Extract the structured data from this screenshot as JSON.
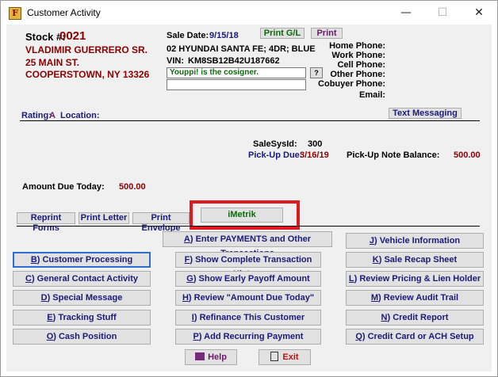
{
  "window": {
    "title": "Customer Activity",
    "icon": "app-logo-icon",
    "controls": {
      "minimize": "—",
      "maximize": "☐",
      "close": "✕"
    }
  },
  "customer": {
    "stock_label": "Stock #:",
    "stock_number": "0021",
    "name": "VLADIMIR GUERRERO SR.",
    "street": "25 MAIN ST.",
    "city_state_zip": "COOPERSTOWN, NY 13326"
  },
  "sale": {
    "sale_date_label": "Sale Date:",
    "sale_date": "9/15/18",
    "vehicle": "02 HYUNDAI SANTA FE; 4DR; BLUE",
    "vin_label": "VIN:",
    "vin": "KM8SB12B42U187662",
    "print_gl_label": "Print G/L",
    "print_label": "Print",
    "cosigner_message": "Youppi! is the cosigner.",
    "help_glyph": "?"
  },
  "phones": {
    "home": "Home Phone:",
    "work": "Work Phone:",
    "cell": "Cell Phone:",
    "other": "Other Phone:",
    "cobuyer": "Cobuyer Phone:",
    "email": "Email:"
  },
  "rating": {
    "rating_label": "Rating:",
    "rating_value": "A",
    "location_label": "Location:"
  },
  "text_messaging_label": "Text Messaging",
  "account": {
    "salesysid_label": "SaleSysId:",
    "salesysid": "300",
    "pickup_due_label": "Pick-Up Due:",
    "pickup_due": "3/16/19",
    "pickup_balance_label": "Pick-Up Note Balance:",
    "pickup_balance": "500.00",
    "amount_due_label": "Amount Due Today:",
    "amount_due": "500.00"
  },
  "tabs": {
    "reprint_forms": "Reprint Forms",
    "print_letter": "Print Letter",
    "print_envelope": "Print Envelope",
    "imetrik": "iMetrik"
  },
  "menu": {
    "a": {
      "key": "A",
      "text": ") Enter PAYMENTS and Other Transactions"
    },
    "b": {
      "key": "B",
      "text": ") Customer Processing"
    },
    "c": {
      "key": "C",
      "text": ") General Contact Activity"
    },
    "d": {
      "key": "D",
      "text": ") Special Message"
    },
    "e": {
      "key": "E",
      "text": ") Tracking Stuff"
    },
    "o": {
      "key": "O",
      "text": ") Cash Position"
    },
    "f": {
      "key": "F",
      "text": ") Show Complete Transaction History"
    },
    "g": {
      "key": "G",
      "text": ") Show Early Payoff Amount"
    },
    "h": {
      "key": "H",
      "text": ") Review \"Amount Due Today\""
    },
    "i": {
      "key": "I",
      "text": ") Refinance This Customer"
    },
    "p": {
      "key": "P",
      "text": ") Add Recurring Payment"
    },
    "j": {
      "key": "J",
      "text": ") Vehicle Information"
    },
    "k": {
      "key": "K",
      "text": ") Sale Recap Sheet"
    },
    "l": {
      "key": "L",
      "text": ") Review Pricing & Lien Holder"
    },
    "m": {
      "key": "M",
      "text": ") Review Audit Trail"
    },
    "n": {
      "key": "N",
      "text": ") Credit Report"
    },
    "q": {
      "key": "Q",
      "text": ") Credit Card or ACH Setup"
    }
  },
  "footer": {
    "help_label": "Help",
    "exit_label": "Exit"
  },
  "colors": {
    "label_navy": "#1a1a7a",
    "value_maroon": "#8b0000",
    "message_green": "#0a6a0a",
    "highlight_red": "#e0191f",
    "focus_blue": "#2a6fd0"
  }
}
